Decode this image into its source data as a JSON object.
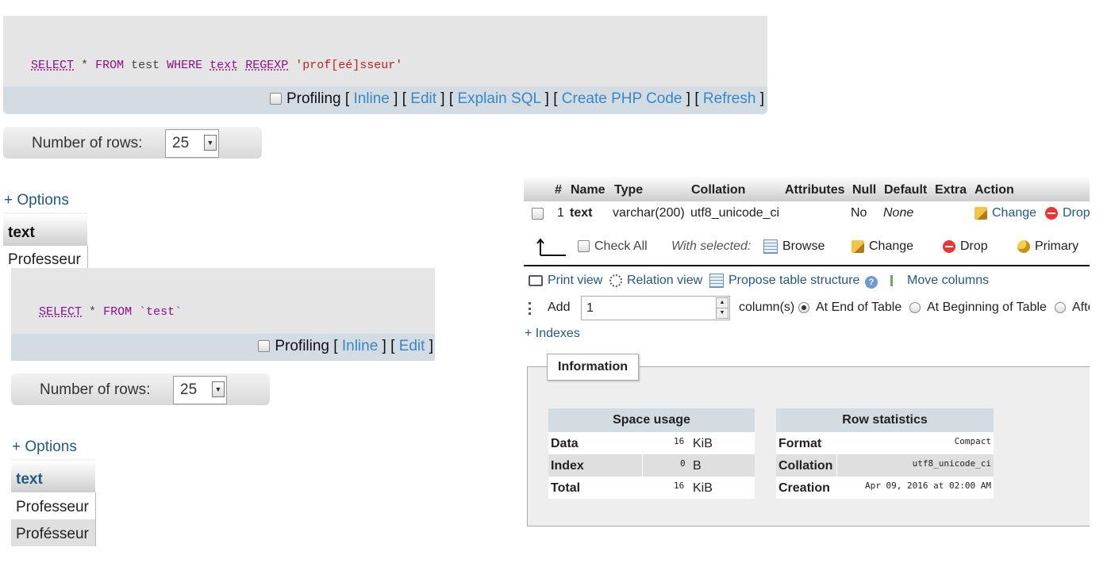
{
  "query1": {
    "kw_select": "SELECT",
    "t_star": "*",
    "kw_from": "FROM",
    "t_table": "test",
    "kw_where": "WHERE",
    "t_field": "text",
    "kw_regexp": "REGEXP",
    "t_pattern": "'prof[eé]sseur'"
  },
  "toolbar1": {
    "profiling": "Profiling",
    "inline": "Inline",
    "edit": "Edit",
    "explain": "Explain SQL",
    "php": "Create PHP Code",
    "refresh": "Refresh"
  },
  "rows1": {
    "label": "Number of rows:",
    "value": "25"
  },
  "options1": "+ Options",
  "result1": {
    "column": "text",
    "rows": [
      "Professeur"
    ]
  },
  "query2": {
    "kw_select": "SELECT",
    "t_star": "*",
    "kw_from": "FROM",
    "t_table": "`test`"
  },
  "toolbar2": {
    "profiling": "Profiling",
    "inline": "Inline",
    "edit": "Edit"
  },
  "rows2": {
    "label": "Number of rows:",
    "value": "25"
  },
  "options2": "+ Options",
  "result2": {
    "column": "text",
    "rows": [
      "Professeur",
      "Profésseur"
    ]
  },
  "structure": {
    "headers": {
      "num": "#",
      "name": "Name",
      "type": "Type",
      "collation": "Collation",
      "attributes": "Attributes",
      "null": "Null",
      "default": "Default",
      "extra": "Extra",
      "action": "Action"
    },
    "row": {
      "num": "1",
      "name": "text",
      "type": "varchar(200)",
      "collation": "utf8_unicode_ci",
      "null": "No",
      "default": "None",
      "change": "Change",
      "drop": "Drop"
    },
    "bulk": {
      "check_all": "Check All",
      "with_selected": "With selected:",
      "browse": "Browse",
      "change": "Change",
      "drop": "Drop",
      "primary": "Primary"
    },
    "links": {
      "print": "Print view",
      "relation": "Relation view",
      "propose": "Propose table structure",
      "move": "Move columns"
    },
    "add": {
      "label": "Add",
      "value": "1",
      "columns": "column(s)",
      "end": "At End of Table",
      "beginning": "At Beginning of Table",
      "after": "Afte"
    },
    "indexes": "+ Indexes"
  },
  "information": {
    "legend": "Information",
    "space": {
      "title": "Space usage",
      "rows": [
        {
          "label": "Data",
          "value": "16",
          "unit": "KiB"
        },
        {
          "label": "Index",
          "value": "0",
          "unit": "B"
        },
        {
          "label": "Total",
          "value": "16",
          "unit": "KiB"
        }
      ]
    },
    "rowstats": {
      "title": "Row statistics",
      "rows": [
        {
          "label": "Format",
          "value": "Compact"
        },
        {
          "label": "Collation",
          "value": "utf8_unicode_ci"
        },
        {
          "label": "Creation",
          "value": "Apr 09, 2016 at 02:00 AM"
        }
      ]
    }
  }
}
